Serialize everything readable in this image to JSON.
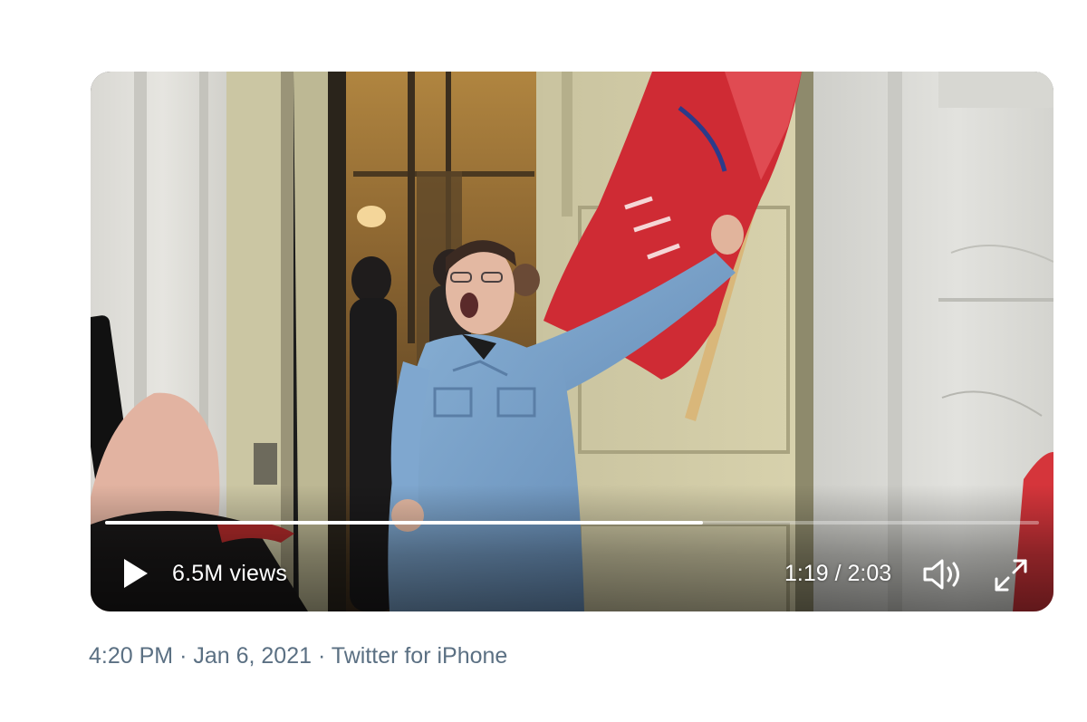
{
  "video": {
    "views": "6.5M views",
    "time_current": "1:19",
    "time_separator": "/",
    "time_total": "2:03",
    "progress_fraction": 0.64,
    "icons": {
      "play": "play-icon",
      "volume": "volume-icon",
      "fullscreen": "fullscreen-icon"
    }
  },
  "tweet": {
    "time": "4:20 PM",
    "date": "Jan 6, 2021",
    "source": "Twitter for iPhone",
    "separator": "·"
  },
  "colors": {
    "meta_text": "#5b7083",
    "controls": "#ffffff",
    "flag_red": "#cf2b34",
    "shirt_blue": "#7aa4cc"
  }
}
